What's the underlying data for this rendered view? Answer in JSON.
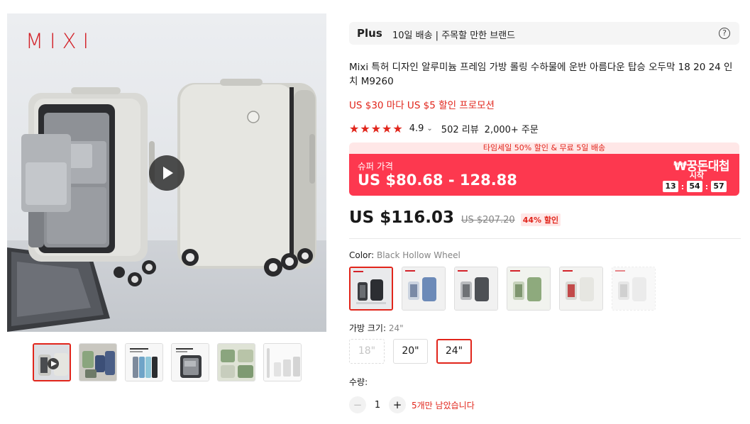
{
  "gallery": {
    "brand": "MIXI",
    "thumbnails": [
      {
        "name": "video-thumb",
        "text": ""
      },
      {
        "name": "green-blue-set",
        "text": ""
      },
      {
        "name": "alloy-frames",
        "text": "Alloy Aluminum Frame"
      },
      {
        "name": "front-opening",
        "text": "Front opening"
      },
      {
        "name": "green-lifestyle",
        "text": ""
      },
      {
        "name": "size-lineup",
        "text": ""
      }
    ]
  },
  "plus_bar": {
    "logo": "Plus",
    "text": "10일 배송 | 주목할 만한 브랜드",
    "help": "?"
  },
  "product": {
    "title": "Mixi 특허 디자인 알루미늄 프레임 가방 롤링 수하물에 운반 아름다운 탑승 오두막 18 20 24 인치 M9260",
    "promo": "US $30 마다 US $5 할인 프로모션",
    "rating": {
      "stars": "★★★★★",
      "score": "4.9",
      "chevron": "⌄",
      "reviews": "502 리뷰",
      "orders": "2,000+ 주문"
    }
  },
  "super_deal": {
    "strip": "타임세일 50% 할인 & 무료 5일 배송",
    "label": "슈퍼 가격",
    "price": "US $80.68 - 128.88",
    "event_logo": "₩꿍돈대첩",
    "event_start": "시작",
    "countdown": [
      "13",
      "54",
      "57"
    ],
    "separator": ":"
  },
  "price": {
    "current": "US $116.03",
    "original": "US $207.20",
    "discount": "44% 할인"
  },
  "color": {
    "label": "Color: ",
    "value": "Black Hollow Wheel",
    "options": [
      "black",
      "blue",
      "gray",
      "green",
      "white-red",
      "light-gray"
    ]
  },
  "size": {
    "label": "가방 크기: ",
    "value": "24\"",
    "options": [
      "18\"",
      "20\"",
      "24\""
    ]
  },
  "quantity": {
    "label": "수량:",
    "minus": "−",
    "value": "1",
    "plus": "+",
    "stock": "5개만 남았습니다"
  },
  "colors": {
    "accent": "#e1251b",
    "super_deal_bg": "#fd384f",
    "strip_bg": "#ffe7e7"
  }
}
